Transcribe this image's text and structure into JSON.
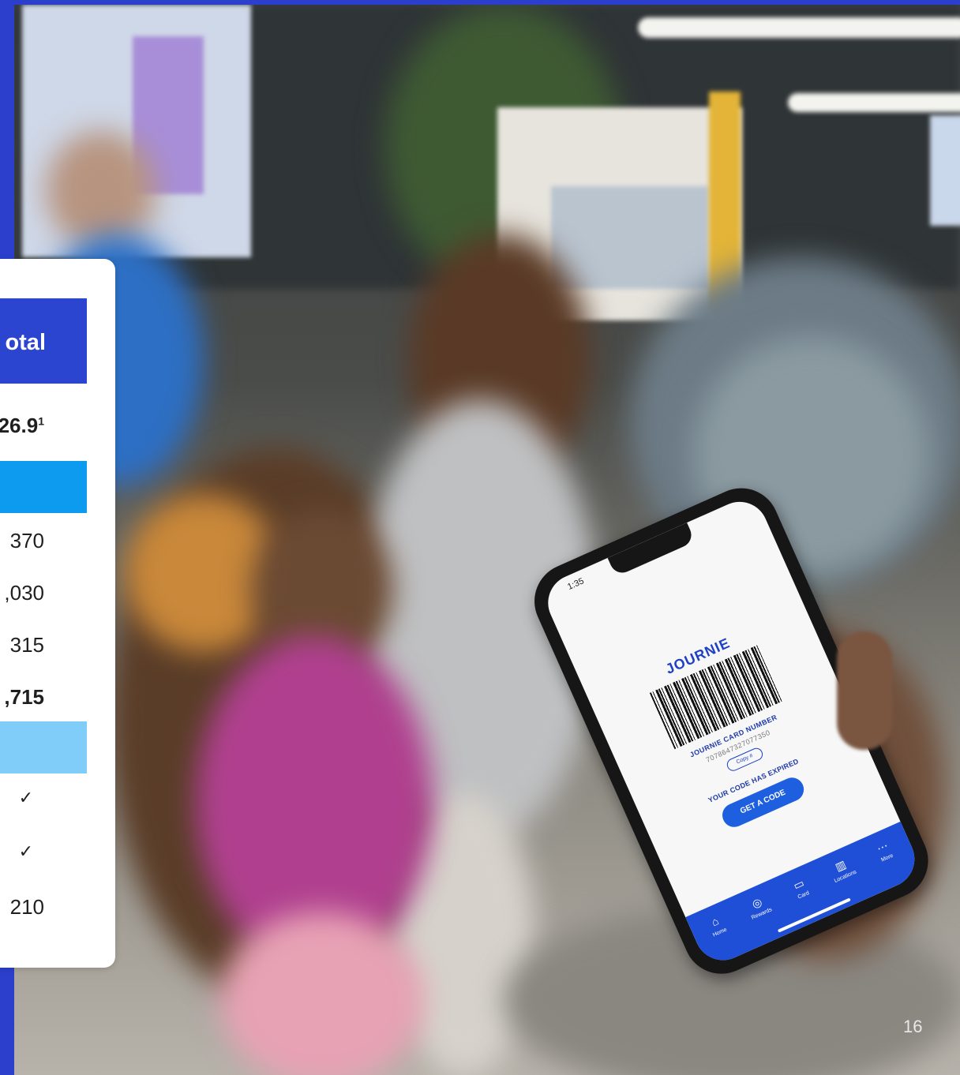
{
  "table": {
    "header": "otal",
    "rows": [
      {
        "value": "26.9",
        "footnote": "1",
        "bold": true
      },
      {
        "value": "370",
        "bold": false
      },
      {
        "value": ",030",
        "bold": false
      },
      {
        "value": "315",
        "bold": false
      },
      {
        "value": ",715",
        "bold": true
      },
      {
        "value": "✓",
        "bold": false
      },
      {
        "value": "✓",
        "bold": false
      },
      {
        "value": "210",
        "bold": false
      }
    ]
  },
  "phone": {
    "time": "1:35",
    "logo": "JOURNIE",
    "card_number_label": "JOURNIE CARD NUMBER",
    "card_number": "7078647327077350",
    "copy_label": "Copy #",
    "expired_text": "YOUR CODE HAS EXPIRED",
    "get_code_label": "GET A CODE",
    "nav": [
      {
        "icon": "⌂",
        "label": "Home"
      },
      {
        "icon": "◎",
        "label": "Rewards"
      },
      {
        "icon": "▭",
        "label": "Card"
      },
      {
        "icon": "▥",
        "label": "Locations"
      },
      {
        "icon": "⋯",
        "label": "More"
      }
    ]
  },
  "page_number": "16",
  "colors": {
    "brand_blue": "#2b45d1",
    "mid_blue": "#0d9bf0",
    "light_blue": "#7fcdf8"
  }
}
